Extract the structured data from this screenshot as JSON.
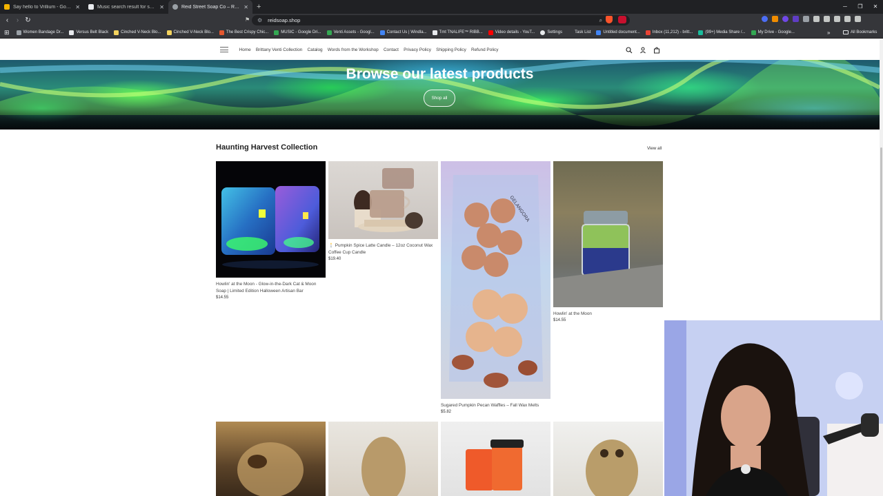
{
  "browser": {
    "tabs": [
      {
        "title": "Say hello to Vrillium - Google Slides",
        "color": "#f4b400",
        "active": false
      },
      {
        "title": "Music search result for synth | Epidemic",
        "color": "#e8eaed",
        "active": false
      },
      {
        "title": "Reid Street Soap Co – Reid Street",
        "color": "#9aa0a6",
        "active": true
      }
    ],
    "new_tab": "+",
    "url": "reidsoap.shop",
    "bookmarks": [
      {
        "label": "Women Bandage Dr...",
        "color": "#9aa0a6"
      },
      {
        "label": "Versus Belt Black",
        "color": "#e8eaed"
      },
      {
        "label": "Cinched V-Neck Blo...",
        "color": "#f4d35e"
      },
      {
        "label": "Cinched V-Neck Blo...",
        "color": "#f4d35e"
      },
      {
        "label": "The Best Crispy Chic...",
        "color": "#e4572e"
      },
      {
        "label": "MUSIC - Google Dri...",
        "color": "#34a853"
      },
      {
        "label": "Venti Assets - Googl...",
        "color": "#34a853"
      },
      {
        "label": "Contact Us | Windla...",
        "color": "#4285f4"
      },
      {
        "label": "Tmt TNALIFE™ RIBB...",
        "color": "#e8eaed"
      },
      {
        "label": "Video details - YouT...",
        "color": "#ff0000"
      },
      {
        "label": "Settings",
        "color": "#e8eaed"
      },
      {
        "label": "Task List",
        "color": "#35363a"
      },
      {
        "label": "Untitled document...",
        "color": "#4285f4"
      },
      {
        "label": "Inbox (11,212) - britt...",
        "color": "#ea4335"
      },
      {
        "label": "(99+) Media Share /...",
        "color": "#1abc9c"
      },
      {
        "label": "My Drive - Google...",
        "color": "#34a853"
      }
    ],
    "bookmarks_more": "»",
    "all_bookmarks": "All Bookmarks"
  },
  "site": {
    "nav": [
      "Home",
      "Brittany Venti Collection",
      "Catalog",
      "Words from the Workshop",
      "Contact",
      "Privacy Policy",
      "Shipping Policy",
      "Refund Policy"
    ],
    "hero": {
      "title": "Browse our latest products",
      "button": "Shop all"
    },
    "collection": {
      "title": "Haunting Harvest Collection",
      "view_all": "View all",
      "products": [
        {
          "name": "Howlin' at the Moon - Glow-in-the-Dark Cat & Moon Soap | Limited Edition Halloween Artisan Bar",
          "price": "$14.55"
        },
        {
          "name": "🕯️ Pumpkin Spice Latte Candle – 12oz Coconut Wax Coffee Cup Candle",
          "price": "$19.40"
        },
        {
          "name": "Sugared Pumpkin Pecan Waffles – Fall Wax Melts",
          "price": "$5.82"
        },
        {
          "name": "Howlin' at the Moon",
          "price": "$14.55"
        }
      ],
      "melt_bag_label": "GELANGORA"
    }
  },
  "colors": {
    "chrome_dark": "#202124",
    "chrome_mid": "#35363a",
    "text": "#222222"
  }
}
